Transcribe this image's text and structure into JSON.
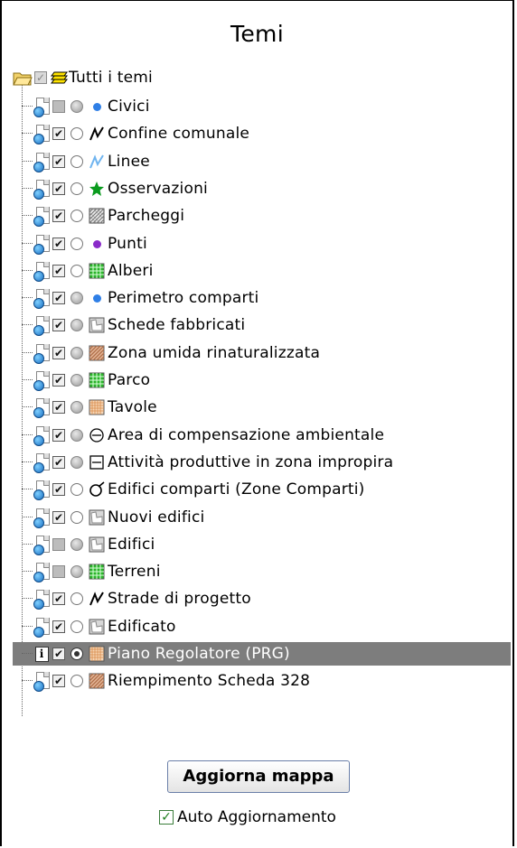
{
  "panel": {
    "title": "Temi"
  },
  "root": {
    "label": "Tutti i temi",
    "icon": "folder-open-icon"
  },
  "layers": [
    {
      "label": "Civici",
      "checked": "partial",
      "radio": "grey",
      "symbol": "dot",
      "color": "#2f7fe6",
      "status_icon": "doc-globe-icon",
      "selected": false
    },
    {
      "label": "Confine comunale",
      "checked": "on",
      "radio": "white",
      "symbol": "line",
      "color": "#000000",
      "status_icon": "doc-globe-icon",
      "selected": false
    },
    {
      "label": "Linee",
      "checked": "on",
      "radio": "white",
      "symbol": "line",
      "color": "#6fb4ef",
      "status_icon": "doc-globe-icon",
      "selected": false
    },
    {
      "label": "Osservazioni",
      "checked": "on",
      "radio": "white",
      "symbol": "star",
      "color": "#0a9b1e",
      "status_icon": "doc-globe-icon",
      "selected": false
    },
    {
      "label": "Parcheggi",
      "checked": "on",
      "radio": "white",
      "symbol": "hatch",
      "color": "#777777",
      "status_icon": "doc-globe-icon",
      "selected": false
    },
    {
      "label": "Punti",
      "checked": "on",
      "radio": "white",
      "symbol": "dot",
      "color": "#8a2bc9",
      "status_icon": "doc-globe-icon",
      "selected": false
    },
    {
      "label": "Alberi",
      "checked": "on",
      "radio": "white",
      "symbol": "grid",
      "color": "#28b428",
      "status_icon": "doc-globe-icon",
      "selected": false
    },
    {
      "label": "Perimetro comparti",
      "checked": "on",
      "radio": "grey",
      "symbol": "dot",
      "color": "#2f7fe6",
      "status_icon": "doc-globe-icon",
      "selected": false
    },
    {
      "label": "Schede fabbricati",
      "checked": "on",
      "radio": "grey",
      "symbol": "polygon",
      "color": "#888888",
      "status_icon": "doc-globe-icon",
      "selected": false
    },
    {
      "label": "Zona umida rinaturalizzata",
      "checked": "on",
      "radio": "grey",
      "symbol": "diag",
      "color": "#b0704a",
      "status_icon": "doc-globe-icon",
      "selected": false
    },
    {
      "label": "Parco",
      "checked": "on",
      "radio": "grey",
      "symbol": "grid",
      "color": "#28b428",
      "status_icon": "doc-globe-icon",
      "selected": false
    },
    {
      "label": "Tavole",
      "checked": "on",
      "radio": "grey",
      "symbol": "dotgrid",
      "color": "#d88a4a",
      "status_icon": "doc-globe-icon",
      "selected": false
    },
    {
      "label": "Area di compensazione ambientale",
      "checked": "on",
      "radio": "grey",
      "symbol": "circle-minus",
      "color": "#000000",
      "status_icon": "doc-globe-icon",
      "selected": false
    },
    {
      "label": "Attività produttive in zona impropira",
      "checked": "on",
      "radio": "grey",
      "symbol": "box-minus",
      "color": "#000000",
      "status_icon": "doc-globe-icon",
      "selected": false
    },
    {
      "label": "Edifici comparti (Zone Comparti)",
      "checked": "on",
      "radio": "white",
      "symbol": "circle-slash",
      "color": "#000000",
      "status_icon": "doc-globe-icon",
      "selected": false
    },
    {
      "label": "Nuovi edifici",
      "checked": "on",
      "radio": "white",
      "symbol": "polygon",
      "color": "#888888",
      "status_icon": "doc-globe-icon",
      "selected": false
    },
    {
      "label": "Edifici",
      "checked": "grey",
      "radio": "grey",
      "symbol": "polygon",
      "color": "#888888",
      "status_icon": "doc-globe-icon",
      "selected": false
    },
    {
      "label": "Terreni",
      "checked": "grey",
      "radio": "grey",
      "symbol": "grid",
      "color": "#28b428",
      "status_icon": "doc-globe-icon",
      "selected": false
    },
    {
      "label": "Strade di progetto",
      "checked": "on",
      "radio": "white",
      "symbol": "line",
      "color": "#000000",
      "status_icon": "doc-globe-icon",
      "selected": false
    },
    {
      "label": "Edificato",
      "checked": "on",
      "radio": "white",
      "symbol": "polygon",
      "color": "#888888",
      "status_icon": "doc-globe-icon",
      "selected": false
    },
    {
      "label": "Piano Regolatore (PRG)",
      "checked": "on",
      "radio": "sel",
      "symbol": "dotgrid",
      "color": "#d88a4a",
      "status_icon": "info-icon",
      "selected": true
    },
    {
      "label": "Riempimento Scheda 328",
      "checked": "on",
      "radio": "white",
      "symbol": "diag",
      "color": "#b0704a",
      "status_icon": "doc-globe-icon",
      "selected": false
    }
  ],
  "actions": {
    "refresh_label": "Aggiorna mappa",
    "auto_label": "Auto Aggiornamento",
    "auto_checked": true
  }
}
